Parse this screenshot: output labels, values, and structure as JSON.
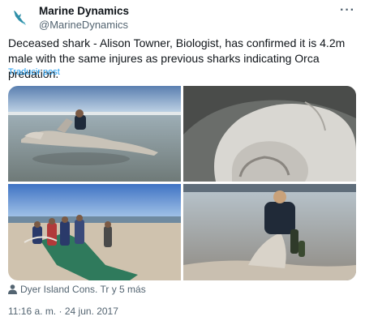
{
  "account": {
    "display_name": "Marine Dynamics",
    "handle": "@MarineDynamics",
    "avatar_icon": "shark-icon",
    "more_label": "···"
  },
  "tweet": {
    "text": "Deceased shark - Alison Towner, Biologist, has confirmed it is 4.2m male with the same injures as previous sharks indicating Orca predation.",
    "translate_label": "Traducir post",
    "tagged": "Dyer Island Cons. Tr y 5 más",
    "time": "11:16 a. m.",
    "separator": "·",
    "date": "24 jun. 2017"
  },
  "media": [
    {
      "alt_icon": "photo-shark-carcass-beach"
    },
    {
      "alt_icon": "photo-shark-closeup"
    },
    {
      "alt_icon": "photo-group-with-tarp"
    },
    {
      "alt_icon": "photo-biologist-with-fin"
    }
  ],
  "colors": {
    "link": "#1d9bf0",
    "secondary_text": "#536471",
    "primary_text": "#0f1419"
  }
}
